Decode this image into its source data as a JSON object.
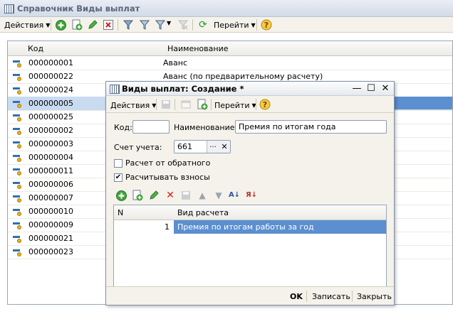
{
  "main": {
    "title": "Справочник Виды выплат",
    "toolbar": {
      "actions_label": "Действия",
      "goto_label": "Перейти"
    },
    "columns": {
      "code": "Код",
      "name": "Наименование"
    },
    "rows": [
      {
        "code": "000000001",
        "name": "Аванс"
      },
      {
        "code": "000000022",
        "name": "Аванс (по предварительному расчету)"
      },
      {
        "code": "000000024",
        "name": ""
      },
      {
        "code": "000000005",
        "name": ""
      },
      {
        "code": "000000025",
        "name": ""
      },
      {
        "code": "000000002",
        "name": ""
      },
      {
        "code": "000000003",
        "name": ""
      },
      {
        "code": "000000004",
        "name": ""
      },
      {
        "code": "000000011",
        "name": ""
      },
      {
        "code": "000000006",
        "name": ""
      },
      {
        "code": "000000007",
        "name": ""
      },
      {
        "code": "000000010",
        "name": ""
      },
      {
        "code": "000000009",
        "name": ""
      },
      {
        "code": "000000021",
        "name": ""
      },
      {
        "code": "000000023",
        "name": ""
      }
    ],
    "selected_row_index": 3
  },
  "dialog": {
    "title": "Виды выплат: Создание *",
    "toolbar": {
      "actions_label": "Действия",
      "goto_label": "Перейти"
    },
    "code_label": "Код:",
    "code_value": "",
    "name_label": "Наименование:",
    "name_value": "Премия по итогам года",
    "account_label": "Счет учета:",
    "account_value": "661",
    "account_select_glyph": "...",
    "account_clear_glyph": "✕",
    "reverse_calc_label": "Расчет от обратного",
    "reverse_calc_checked": false,
    "calc_contrib_label": "Расчитывать взносы",
    "calc_contrib_checked": true,
    "calc_table": {
      "columns": {
        "n": "N",
        "type": "Вид расчета"
      },
      "rows": [
        {
          "n": "1",
          "type": "Премия по итогам работы за год"
        }
      ]
    },
    "buttons": {
      "ok": "OK",
      "save": "Записать",
      "close": "Закрыть"
    }
  },
  "colors": {
    "selection": "#5b8fd0",
    "selection_light": "#c9dbf1"
  }
}
